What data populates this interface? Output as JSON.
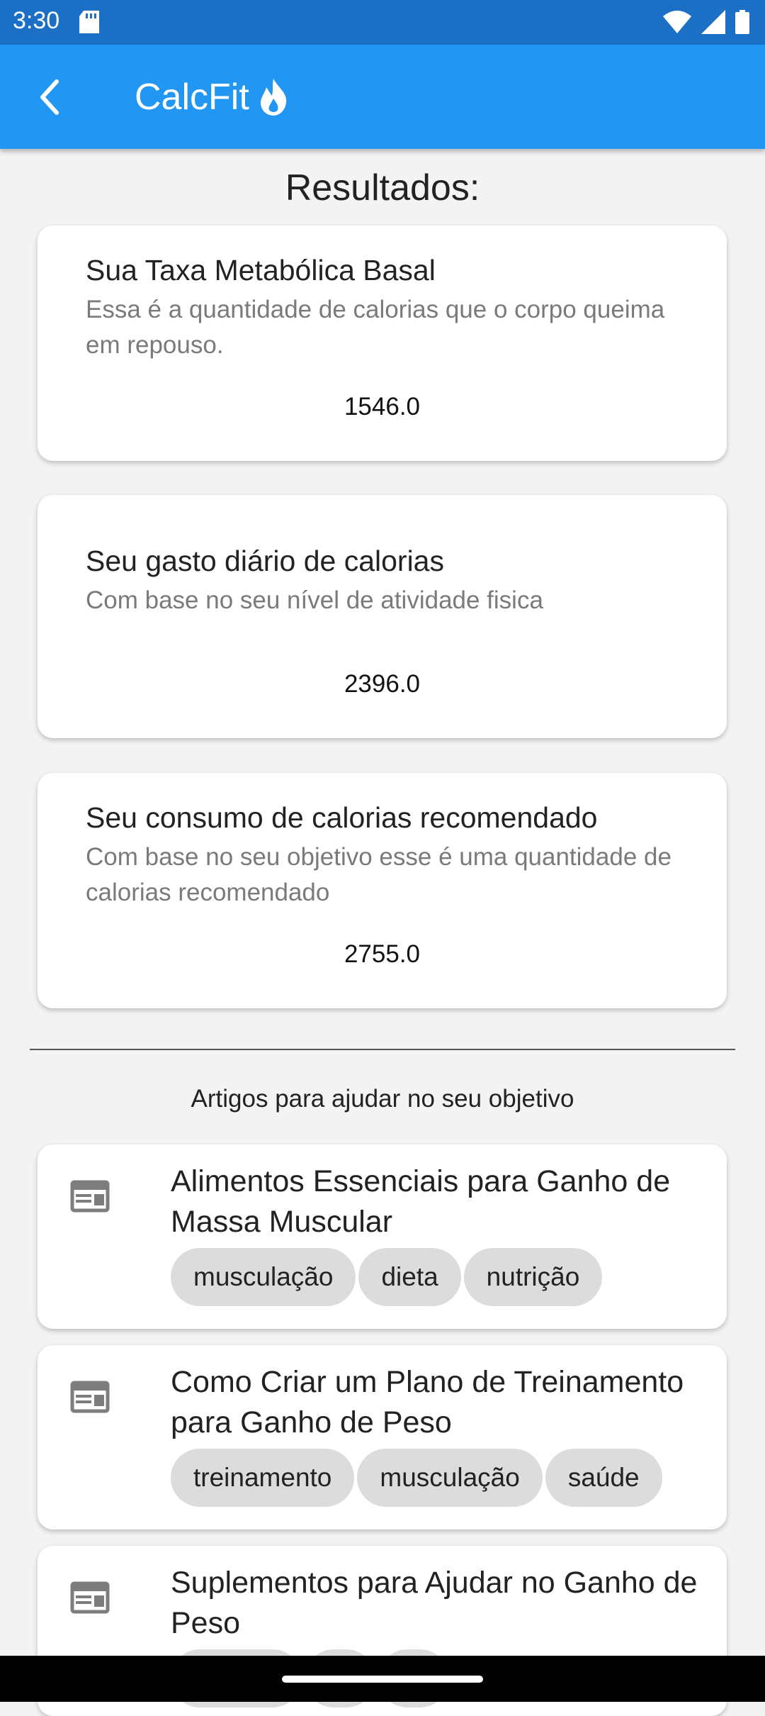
{
  "status_bar": {
    "time": "3:30",
    "icons": [
      "sd-card-icon",
      "wifi-icon",
      "signal-icon",
      "battery-icon"
    ]
  },
  "app_bar": {
    "title": "CalcFit",
    "color": "#2196f3",
    "icons": [
      "back-arrow-icon",
      "flame-icon"
    ]
  },
  "results": {
    "heading": "Resultados:",
    "cards": [
      {
        "title": "Sua Taxa Metabólica Basal",
        "subtitle": "Essa é a quantidade de calorias que o corpo queima em repouso.",
        "value": "1546.0"
      },
      {
        "title": "Seu gasto diário de calorias",
        "subtitle": "Com base no seu nível de atividade fisica",
        "value": "2396.0"
      },
      {
        "title": "Seu consumo de calorias recomendado",
        "subtitle": "Com base no seu objetivo esse é uma quantidade de calorias recomendado",
        "value": "2755.0"
      }
    ]
  },
  "articles": {
    "label": "Artigos para ajudar no seu objetivo",
    "items": [
      {
        "icon": "article-icon",
        "title": "Alimentos Essenciais para Ganho de Massa Muscular",
        "tags": [
          "musculação",
          "dieta",
          "nutrição"
        ]
      },
      {
        "icon": "article-icon",
        "title": "Como Criar um Plano de Treinamento para Ganho de Peso",
        "tags": [
          "treinamento",
          "musculação",
          "saúde"
        ]
      },
      {
        "icon": "article-icon",
        "title": "Suplementos para Ajudar no Ganho de Peso",
        "tags": []
      }
    ]
  }
}
